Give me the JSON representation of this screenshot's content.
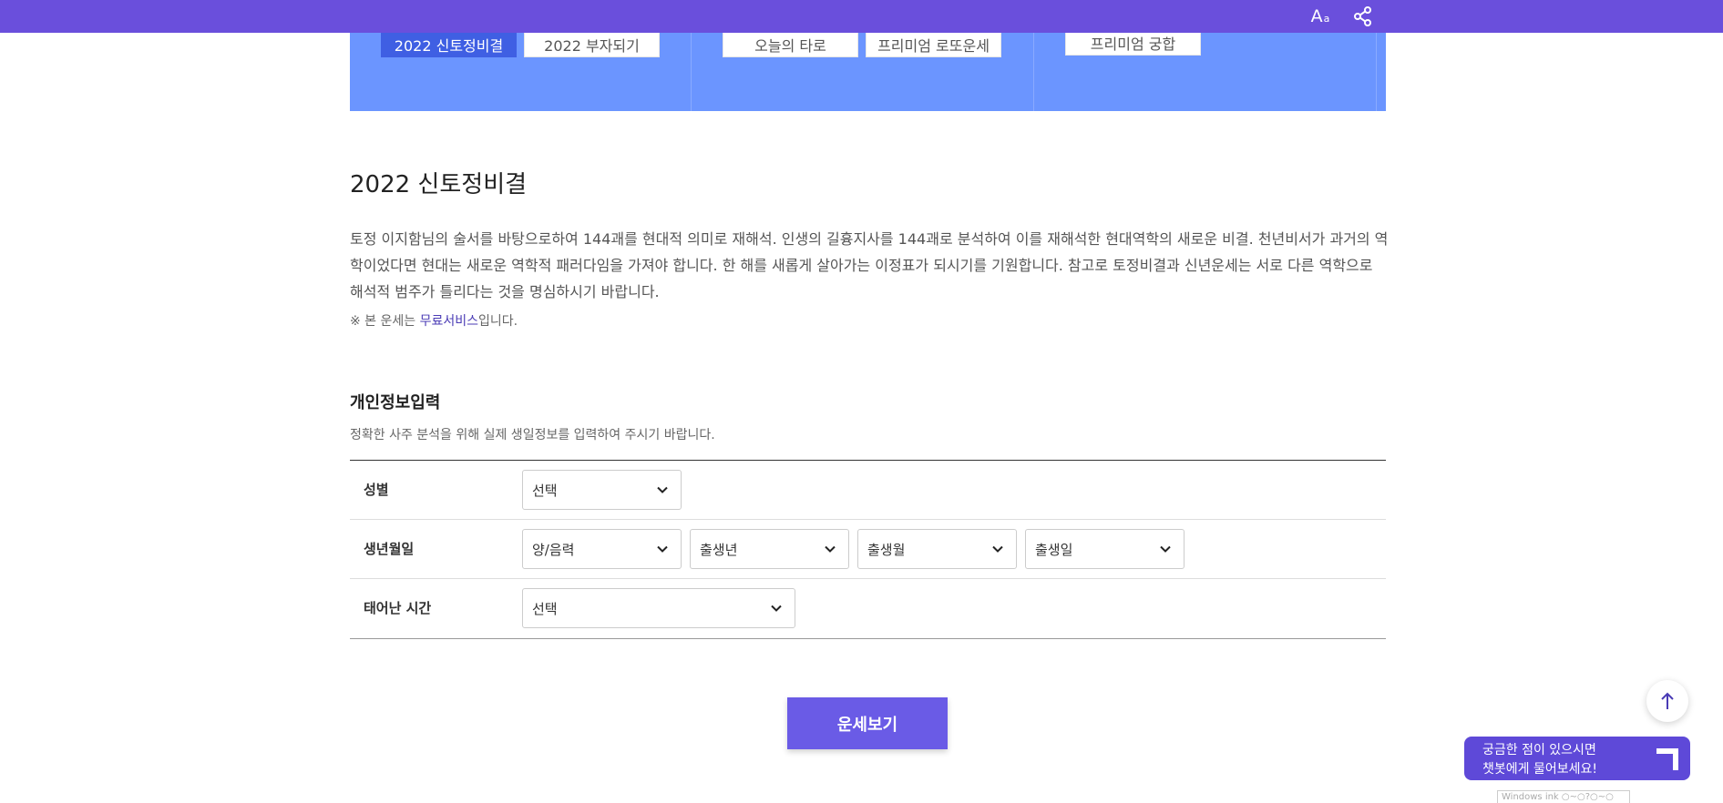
{
  "topbar": {
    "font_size_label": "A",
    "font_size_small": "a",
    "share_icon": "share-icon"
  },
  "banner": {
    "buttons": [
      {
        "label": "2022 신토정비결",
        "active": true
      },
      {
        "label": "2022 부자되기"
      },
      {
        "label": "오늘의 타로"
      },
      {
        "label": "프리미엄 로또운세"
      },
      {
        "label": "프리미엄 궁합"
      }
    ]
  },
  "main": {
    "title": "2022 신토정비결",
    "description": "토정 이지함님의 술서를 바탕으로하여 144괘를 현대적 의미로 재해석. 인생의 길흉지사를 144괘로 분석하여 이를 재해석한 현대역학의 새로운 비결. 천년비서가 과거의 역학이었다면 현대는 새로운 역학적 패러다임을 가져야 합니다. 한 해를 새롭게 살아가는 이정표가 되시기를 기원합니다. 참고로 토정비결과 신년운세는 서로 다른 역학으로 해석적 범주가 틀리다는 것을 명심하시기 바랍니다.",
    "notice_prefix": "※ 본 운세는 ",
    "notice_highlight": "무료서비스",
    "notice_suffix": "입니다."
  },
  "form": {
    "title": "개인정보입력",
    "description": "정확한 사주 분석을 위해 실제 생일정보를 입력하여 주시기 바랍니다.",
    "gender": {
      "label": "성별",
      "value": "선택"
    },
    "birth": {
      "label": "생년월일",
      "calendar": "양/음력",
      "year": "출생년",
      "month": "출생월",
      "day": "출생일"
    },
    "time": {
      "label": "태어난 시간",
      "value": "선택"
    },
    "submit_label": "운세보기"
  },
  "chat": {
    "line1": "궁금한 점이 있으시면",
    "line2": "챗봇에게 물어보세요!"
  },
  "watermark": "Windows ink ○~○?○~○"
}
